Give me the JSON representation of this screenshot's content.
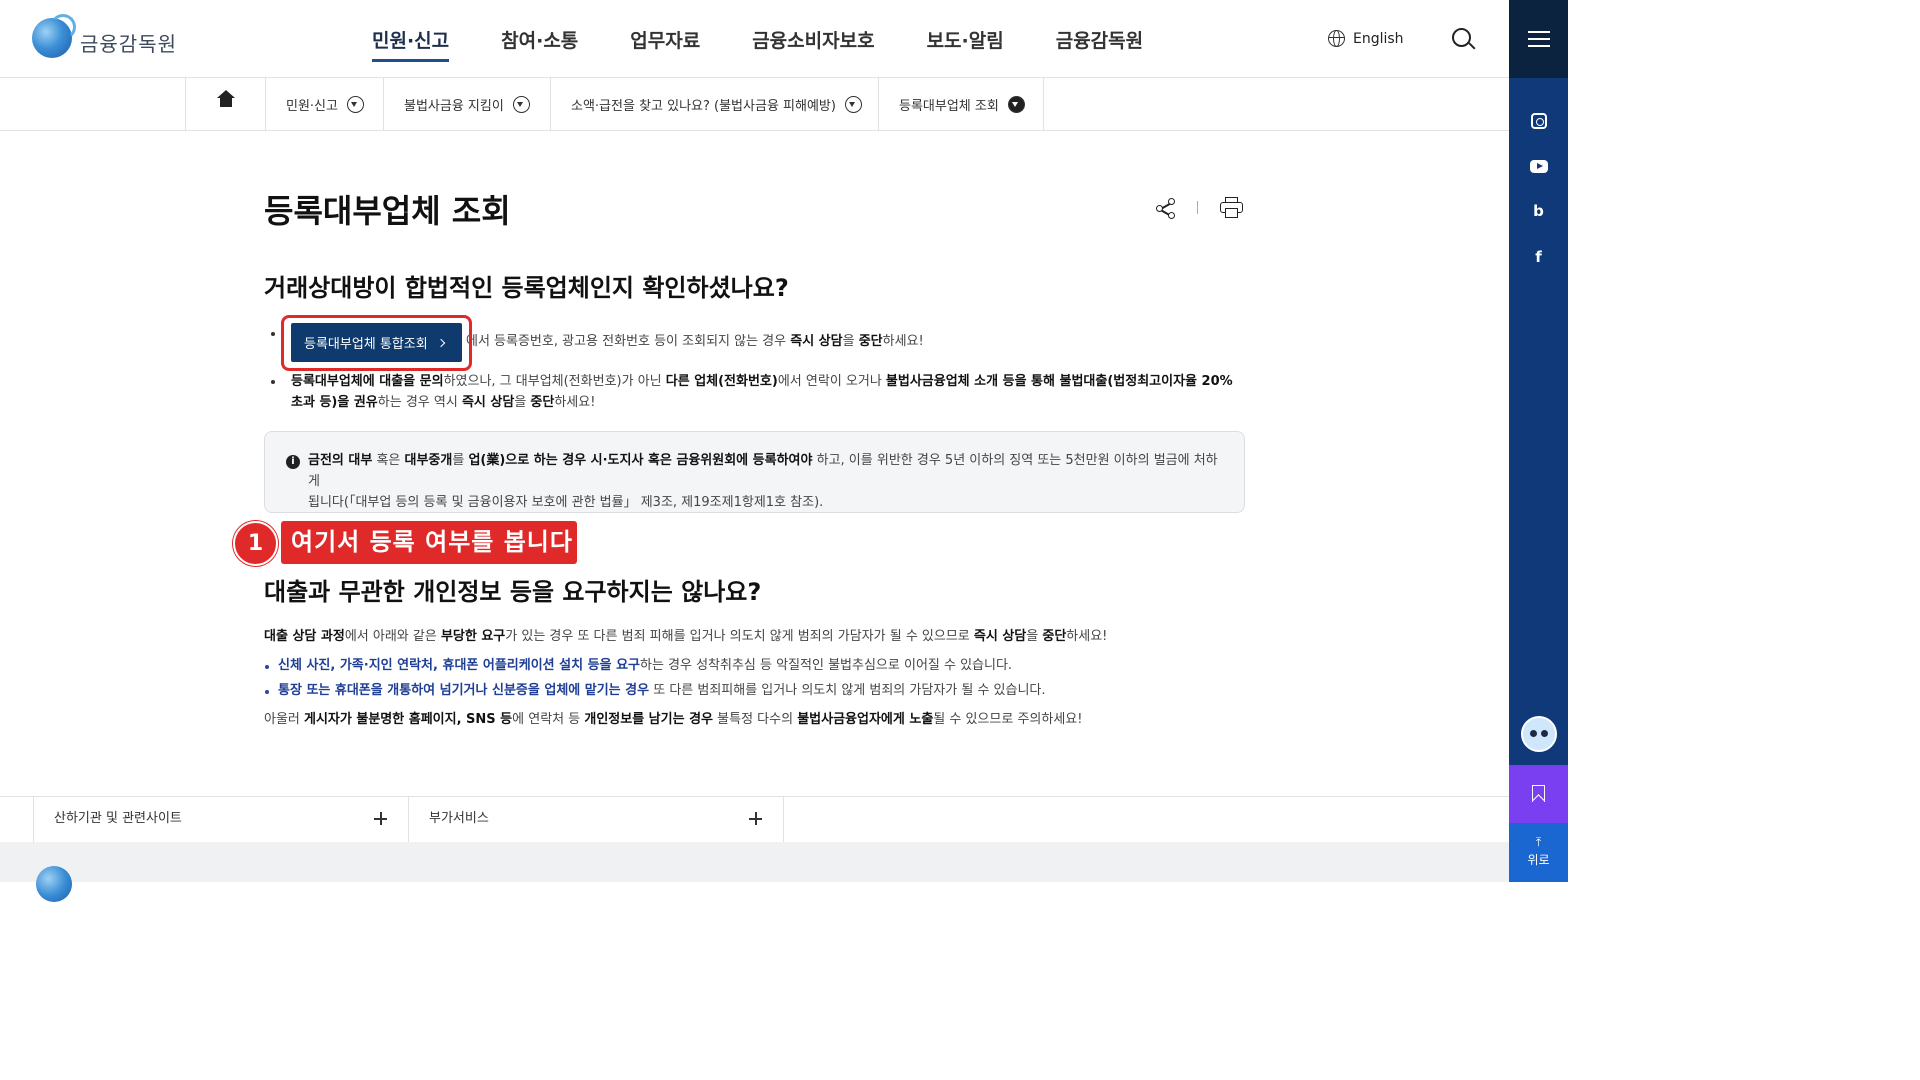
{
  "header": {
    "logo_text": "금융감독원",
    "nav": [
      "민원·신고",
      "참여·소통",
      "업무자료",
      "금융소비자보호",
      "보도·알림",
      "금융감독원"
    ],
    "lang_label": "English"
  },
  "breadcrumb": {
    "items": [
      "민원·신고",
      "불법사금융 지킴이",
      "소액·급전을 찾고 있나요? (불법사금융 피해예방)",
      "등록대부업체 조회"
    ]
  },
  "page": {
    "title": "등록대부업체 조회"
  },
  "section1": {
    "heading": "거래상대방이 합법적인 등록업체인지 확인하셨나요?",
    "lookup_button": "등록대부업체 통합조회",
    "bullet1_rest": "에서 등록증번호, 광고용 전화번호 등이 조회되지 않는 경우 ",
    "bullet1_bold1": "즉시 상담",
    "bullet1_mid": "을 ",
    "bullet1_bold2": "중단",
    "bullet1_end": "하세요!",
    "bullet2": {
      "b1": "등록대부업체에 대출을 문의",
      "t1": "하였으나, 그 대부업체(전화번호)가 아닌 ",
      "b2": "다른 업체(전화번호)",
      "t2": "에서 연락이 오거나 ",
      "b3": "불법사금융업체 소개 등을 통해 불법대출(법정최고이자율 20%",
      "b4": "초과 등)을 권유",
      "t3": "하는 경우 역시 ",
      "b5": "즉시 상담",
      "t4": "을 ",
      "b6": "중단",
      "t5": "하세요!"
    },
    "notice": {
      "b1": "금전의 대부",
      "t1": " 혹은 ",
      "b2": "대부중개",
      "t2": "를 ",
      "b3": "업(業)으로 하는 경우 시·도지사 혹은 금융위원회에 등록하여야",
      "t3": " 하고, 이를 위반한 경우 5년 이하의 징역 또는 5천만원 이하의 벌금에 처하게",
      "line2": "됩니다(「대부업 등의 등록 및 금융이용자 보호에 관한 법률」 제3조, 제19조제1항제1호 참조)."
    }
  },
  "annotation": {
    "step": "1",
    "label": "여기서 등록 여부를 봅니다"
  },
  "section2": {
    "heading": "대출과 무관한 개인정보 등을 요구하지는 않나요?",
    "p1": {
      "b1": "대출 상담 과정",
      "t1": "에서 아래와 같은 ",
      "b2": "부당한 요구",
      "t2": "가 있는 경우 또 다른 범죄 피해를 입거나 의도치 않게 범죄의 가담자가 될 수 있으므로 ",
      "b3": "즉시 상담",
      "t3": "을 ",
      "b4": "중단",
      "t4": "하세요!"
    },
    "li1": {
      "bold": "신체 사진, 가족·지인 연락처, 휴대폰 어플리케이션 설치 등을 요구",
      "rest": "하는 경우 성착취추심 등 악질적인 불법추심으로 이어질 수 있습니다."
    },
    "li2": {
      "bold": "통장 또는 휴대폰을 개통하여 넘기거나 신분증을 업체에 맡기는 경우",
      "rest": " 또 다른 범죄피해를 입거나 의도치 않게 범죄의 가담자가 될 수 있습니다."
    },
    "p2": {
      "t1": "아울러 ",
      "b1": "게시자가 불분명한 홈페이지, SNS 등",
      "t2": "에 연락처 등 ",
      "b2": "개인정보를 남기는 경우",
      "t3": " 불특정 다수의 ",
      "b3": "불법사금융업자에게 노출",
      "t4": "될 수 있으므로 주의하세요!"
    }
  },
  "footer": {
    "cells": [
      "산하기관 및 관련사이트",
      "부가서비스"
    ]
  },
  "rail": {
    "blog_label": "b",
    "facebook_label": "f",
    "top_label": "위로"
  }
}
